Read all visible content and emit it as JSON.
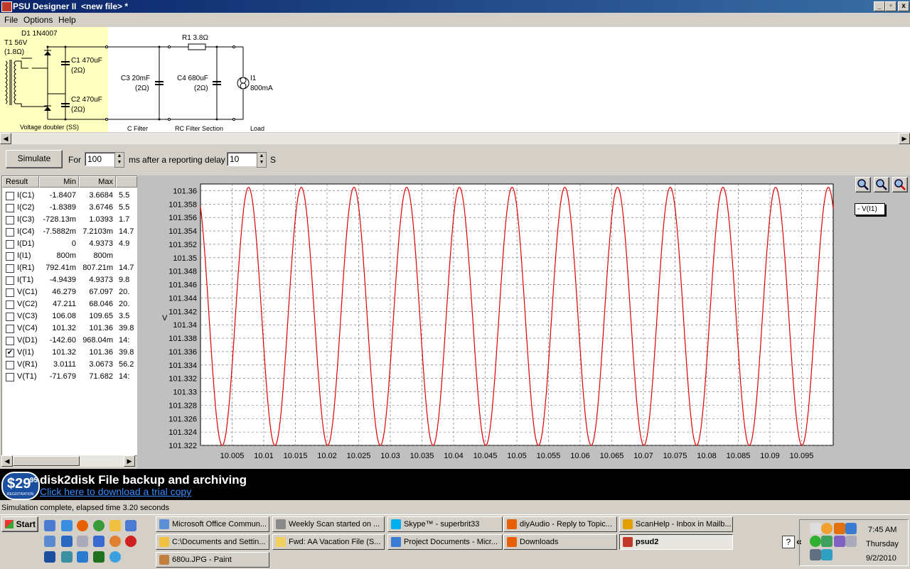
{
  "window": {
    "title": "PSU Designer II  <new file> *",
    "min": "_",
    "max": "▫",
    "close": "x"
  },
  "menu": [
    "File",
    "Options",
    "Help"
  ],
  "schematic": {
    "d1": "D1 1N4007",
    "t1": "T1 56V",
    "t1r": "(1.8Ω)",
    "c1": "C1 470uF",
    "c1r": "(2Ω)",
    "c2": "C2 470uF",
    "c2r": "(2Ω)",
    "section1": "Voltage doubler (SS)",
    "c3": "C3 20mF",
    "c3r": "(2Ω)",
    "section2": "C Filter",
    "r1": "R1 3.8Ω",
    "c4": "C4 680uF",
    "c4r": "(2Ω)",
    "section3": "RC Filter Section",
    "i1": "I1",
    "i1v": "800mA",
    "section4": "Load"
  },
  "sim": {
    "button": "Simulate",
    "for_label": "For",
    "duration": "100",
    "unit_ms": "ms",
    "delay_label": "after a reporting delay of",
    "delay": "10",
    "unit_s": "S"
  },
  "results": {
    "headers": [
      "Result",
      "Min",
      "Max"
    ],
    "rows": [
      {
        "name": "I(C1)",
        "min": "-1.8407",
        "max": "3.6684",
        "extra": "5.5",
        "checked": false
      },
      {
        "name": "I(C2)",
        "min": "-1.8389",
        "max": "3.6746",
        "extra": "5.5",
        "checked": false
      },
      {
        "name": "I(C3)",
        "min": "-728.13m",
        "max": "1.0393",
        "extra": "1.7",
        "checked": false
      },
      {
        "name": "I(C4)",
        "min": "-7.5882m",
        "max": "7.2103m",
        "extra": "14.7",
        "checked": false
      },
      {
        "name": "I(D1)",
        "min": "0",
        "max": "4.9373",
        "extra": "4.9",
        "checked": false
      },
      {
        "name": "I(I1)",
        "min": "800m",
        "max": "800m",
        "extra": "",
        "checked": false
      },
      {
        "name": "I(R1)",
        "min": "792.41m",
        "max": "807.21m",
        "extra": "14.7",
        "checked": false
      },
      {
        "name": "I(T1)",
        "min": "-4.9439",
        "max": "4.9373",
        "extra": "9.8",
        "checked": false
      },
      {
        "name": "V(C1)",
        "min": "46.279",
        "max": "67.097",
        "extra": "20.",
        "checked": false
      },
      {
        "name": "V(C2)",
        "min": "47.211",
        "max": "68.046",
        "extra": "20.",
        "checked": false
      },
      {
        "name": "V(C3)",
        "min": "106.08",
        "max": "109.65",
        "extra": "3.5",
        "checked": false
      },
      {
        "name": "V(C4)",
        "min": "101.32",
        "max": "101.36",
        "extra": "39.8",
        "checked": false
      },
      {
        "name": "V(D1)",
        "min": "-142.60",
        "max": "968.04m",
        "extra": "14:",
        "checked": false
      },
      {
        "name": "V(I1)",
        "min": "101.32",
        "max": "101.36",
        "extra": "39.8",
        "checked": true
      },
      {
        "name": "V(R1)",
        "min": "3.0111",
        "max": "3.0673",
        "extra": "56.2",
        "checked": false
      },
      {
        "name": "V(T1)",
        "min": "-71.679",
        "max": "71.682",
        "extra": "14:",
        "checked": false
      }
    ]
  },
  "chart_data": {
    "type": "line",
    "ylabel": "V",
    "legend": "- V(I1)",
    "legend_position": "top-right",
    "grid": true,
    "xlim": [
      10.0,
      10.1
    ],
    "ylim": [
      101.322,
      101.361
    ],
    "xticks": [
      "10.005",
      "10.01",
      "10.015",
      "10.02",
      "10.025",
      "10.03",
      "10.035",
      "10.04",
      "10.045",
      "10.05",
      "10.055",
      "10.06",
      "10.065",
      "10.07",
      "10.075",
      "10.08",
      "10.085",
      "10.09",
      "10.095"
    ],
    "yticks": [
      "101.36",
      "101.358",
      "101.356",
      "101.354",
      "101.352",
      "101.35",
      "101.348",
      "101.346",
      "101.344",
      "101.342",
      "101.34",
      "101.338",
      "101.336",
      "101.334",
      "101.332",
      "101.33",
      "101.328",
      "101.326",
      "101.324",
      "101.322"
    ],
    "series": [
      {
        "name": "V(I1)",
        "color": "#e00000",
        "period": 0.00833,
        "min": 101.322,
        "max": 101.3605,
        "first_peak": 10.0076,
        "x": [
          10.0,
          10.0038,
          10.0076,
          10.0118,
          10.0159,
          10.0201,
          10.0243,
          10.0284,
          10.0326,
          10.0368,
          10.0409,
          10.0451,
          10.0493,
          10.0534,
          10.0576,
          10.0618,
          10.0659,
          10.0701,
          10.0743,
          10.0784,
          10.0826,
          10.0868,
          10.0909,
          10.0951,
          10.1
        ],
        "y": [
          101.357,
          101.322,
          101.3605,
          101.322,
          101.3605,
          101.322,
          101.3605,
          101.322,
          101.3605,
          101.322,
          101.3605,
          101.322,
          101.3605,
          101.322,
          101.3605,
          101.322,
          101.3605,
          101.322,
          101.3605,
          101.322,
          101.3605,
          101.322,
          101.3605,
          101.322,
          101.355
        ]
      }
    ]
  },
  "banner": {
    "price": "$29",
    "cents": "95",
    "sub": "REGISTRATION",
    "title": "disk2disk File backup and archiving",
    "link": "Click here to download a trial copy"
  },
  "status": "Simulation complete, elapsed time 3.20 seconds",
  "taskbar": {
    "start": "Start",
    "buttons": [
      {
        "label": "Microsoft Office Commun...",
        "color": "#5b8fd8"
      },
      {
        "label": "Weekly Scan started on ...",
        "color": "#8a8a8a"
      },
      {
        "label": "Skype™ - superbrit33",
        "color": "#00aff0"
      },
      {
        "label": "diyAudio - Reply to Topic...",
        "color": "#e66000"
      },
      {
        "label": "ScanHelp - Inbox in Mailb...",
        "color": "#e0a000"
      },
      {
        "label": "C:\\Documents and Settin...",
        "color": "#f0c040"
      },
      {
        "label": "Fwd: AA Vacation File (S...",
        "color": "#f0d060"
      },
      {
        "label": "Project Documents - Micr...",
        "color": "#3a7bd5"
      },
      {
        "label": "Downloads",
        "color": "#e66000"
      },
      {
        "label": "psud2",
        "color": "#c0392b",
        "active": true
      },
      {
        "label": "680u.JPG - Paint",
        "color": "#c08040"
      }
    ],
    "clock": {
      "time": "7:45 AM",
      "day": "Thursday",
      "date": "9/2/2010"
    }
  }
}
